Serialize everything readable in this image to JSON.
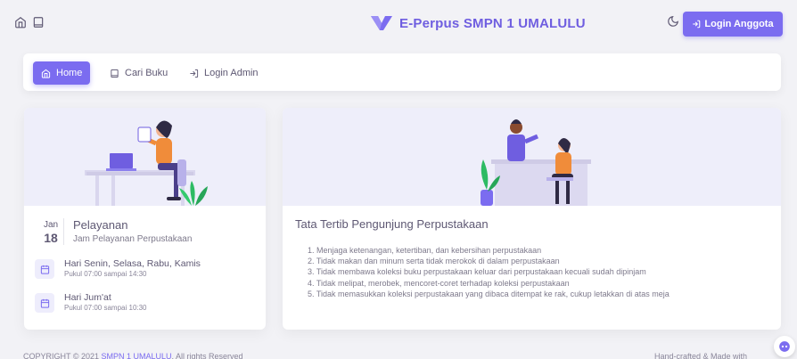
{
  "header": {
    "brand_title": "E-Perpus SMPN 1 UMALULU",
    "login_button": "Login Anggota",
    "icons": [
      "home-icon",
      "book-icon",
      "moon-icon"
    ],
    "accent_color": "#7b6cf0"
  },
  "nav": {
    "items": [
      {
        "label": "Home",
        "icon": "home-icon",
        "active": true
      },
      {
        "label": "Cari Buku",
        "icon": "book-icon",
        "active": false
      },
      {
        "label": "Login Admin",
        "icon": "login-icon",
        "active": false
      }
    ]
  },
  "service_card": {
    "month": "Jan",
    "day": "18",
    "title": "Pelayanan",
    "subtitle": "Jam Pelayanan Perpustakaan",
    "schedules": [
      {
        "days": "Hari Senin, Selasa, Rabu, Kamis",
        "time": "Pukul 07:00 sampai 14:30"
      },
      {
        "days": "Hari Jum'at",
        "time": "Pukul 07:00 sampai 10:30"
      }
    ]
  },
  "rules_card": {
    "title": "Tata Tertib Pengunjung Perpustakaan",
    "rules": [
      "1. Menjaga ketenangan, ketertiban, dan kebersihan perpustakaan",
      "2. Tidak makan dan minum serta tidak merokok di dalam perpustakaan",
      "3. Tidak membawa koleksi buku perpustakaan keluar dari perpustakaan kecuali sudah dipinjam",
      "4. Tidak melipat, merobek, mencoret-coret terhadap koleksi perpustakaan",
      "5. Tidak memasukkan koleksi perpustakaan yang dibaca ditempat ke rak, cukup letakkan di atas meja"
    ]
  },
  "footer": {
    "copyright_prefix": "COPYRIGHT © 2021 ",
    "copyright_link": "SMPN 1 UMALULU",
    "copyright_suffix": ", All rights Reserved",
    "credit": "Hand-crafted & Made with"
  }
}
